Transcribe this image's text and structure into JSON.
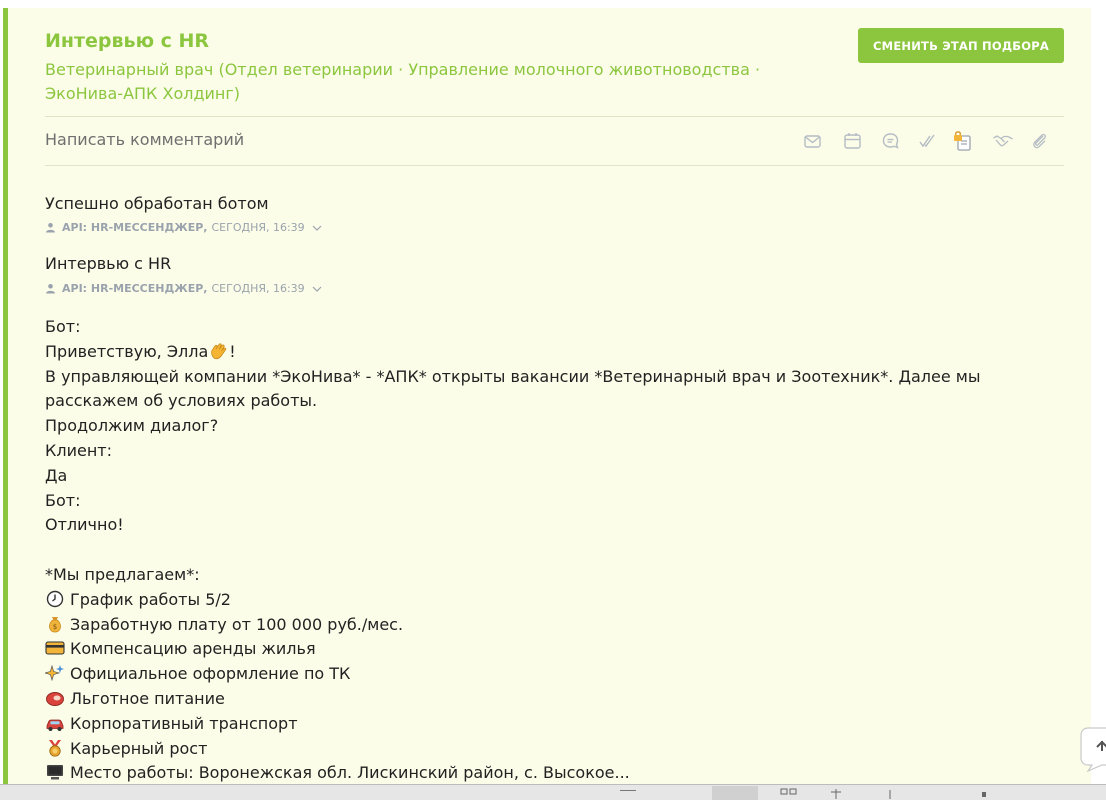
{
  "header": {
    "stage_title": "Интервью с HR",
    "vacancy_line1": "Ветеринарный врач (Отдел ветеринарии · Управление молочного животноводства ·",
    "vacancy_line2": "ЭкоНива-АПК Холдинг)",
    "change_stage_button": "СМЕНИТЬ ЭТАП ПОДБОРА"
  },
  "comment": {
    "placeholder": "Написать комментарий"
  },
  "toolbar": [
    "mail-icon",
    "calendar-icon",
    "chat-icon",
    "double-check-icon",
    "locked-clipboard-icon",
    "handshake-icon",
    "paperclip-icon"
  ],
  "events": [
    {
      "title": "Успешно обработан ботом",
      "author": "API: HR-МЕССЕНДЖЕР,",
      "time": "СЕГОДНЯ, 16:39"
    },
    {
      "title": "Интервью с HR",
      "author": "API: HR-МЕССЕНДЖЕР,",
      "time": "СЕГОДНЯ, 16:39"
    }
  ],
  "message": {
    "l1": "Бот:",
    "l2": "Приветствую, Элла",
    "l2_end": "!",
    "l3": "В управляющей компании *ЭкоНива* - *АПК* открыты вакансии *Ветеринарный врач и Зоотехник*. Далее мы",
    "l4": "расскажем об условиях работы.",
    "l5": "Продолжим диалог?",
    "l6": "Клиент:",
    "l7": "Да",
    "l8": "Бот:",
    "l9": "Отлично!",
    "offer_title": "*Мы предлагаем*:",
    "offers": [
      {
        "icon": "clock-icon",
        "text": "График работы 5/2"
      },
      {
        "icon": "money-bag-icon",
        "text": "Заработную плату от 100 000 руб./мес."
      },
      {
        "icon": "credit-card-icon",
        "text": "Компенсацию аренды жилья"
      },
      {
        "icon": "sparkles-icon",
        "text": "Официальное оформление по ТК"
      },
      {
        "icon": "meat-icon",
        "text": "Льготное питание"
      },
      {
        "icon": "car-icon",
        "text": "Корпоративный транспорт"
      },
      {
        "icon": "medal-icon",
        "text": "Карьерный рост"
      },
      {
        "icon": "computer-icon",
        "text": "Место работы: Воронежская обл. Лискинский район, с. Высокое..."
      }
    ]
  },
  "colors": {
    "accent": "#8cc63f",
    "card_bg": "#fbfde8",
    "meta": "#9aa3ad",
    "text": "#222222"
  }
}
